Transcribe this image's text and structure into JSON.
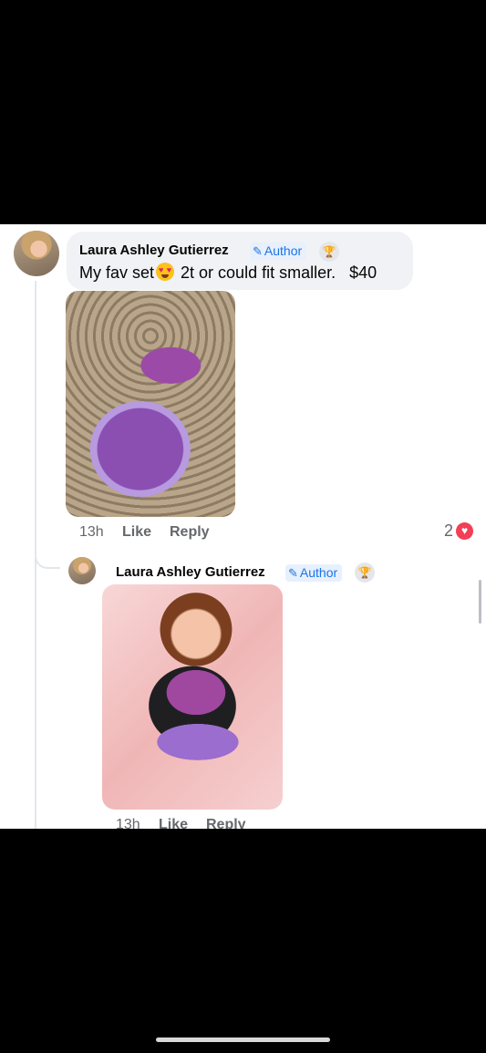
{
  "comment": {
    "author": "Laura Ashley Gutierrez",
    "badge": "Author",
    "text_before_emoji": "My fav set",
    "emoji": "heart-eyes-emoji",
    "text_after_emoji": " 2t or could fit smaller.   $40",
    "time": "13h",
    "like_label": "Like",
    "reply_label": "Reply",
    "reaction_count": "2",
    "reaction_icon": "heart-icon"
  },
  "reply": {
    "author": "Laura Ashley Gutierrez",
    "badge": "Author",
    "time": "13h",
    "like_label": "Like",
    "reply_label": "Reply"
  },
  "colors": {
    "badge_text": "#1b74e4",
    "bubble": "#f0f2f5",
    "reaction": "#f33e58"
  }
}
